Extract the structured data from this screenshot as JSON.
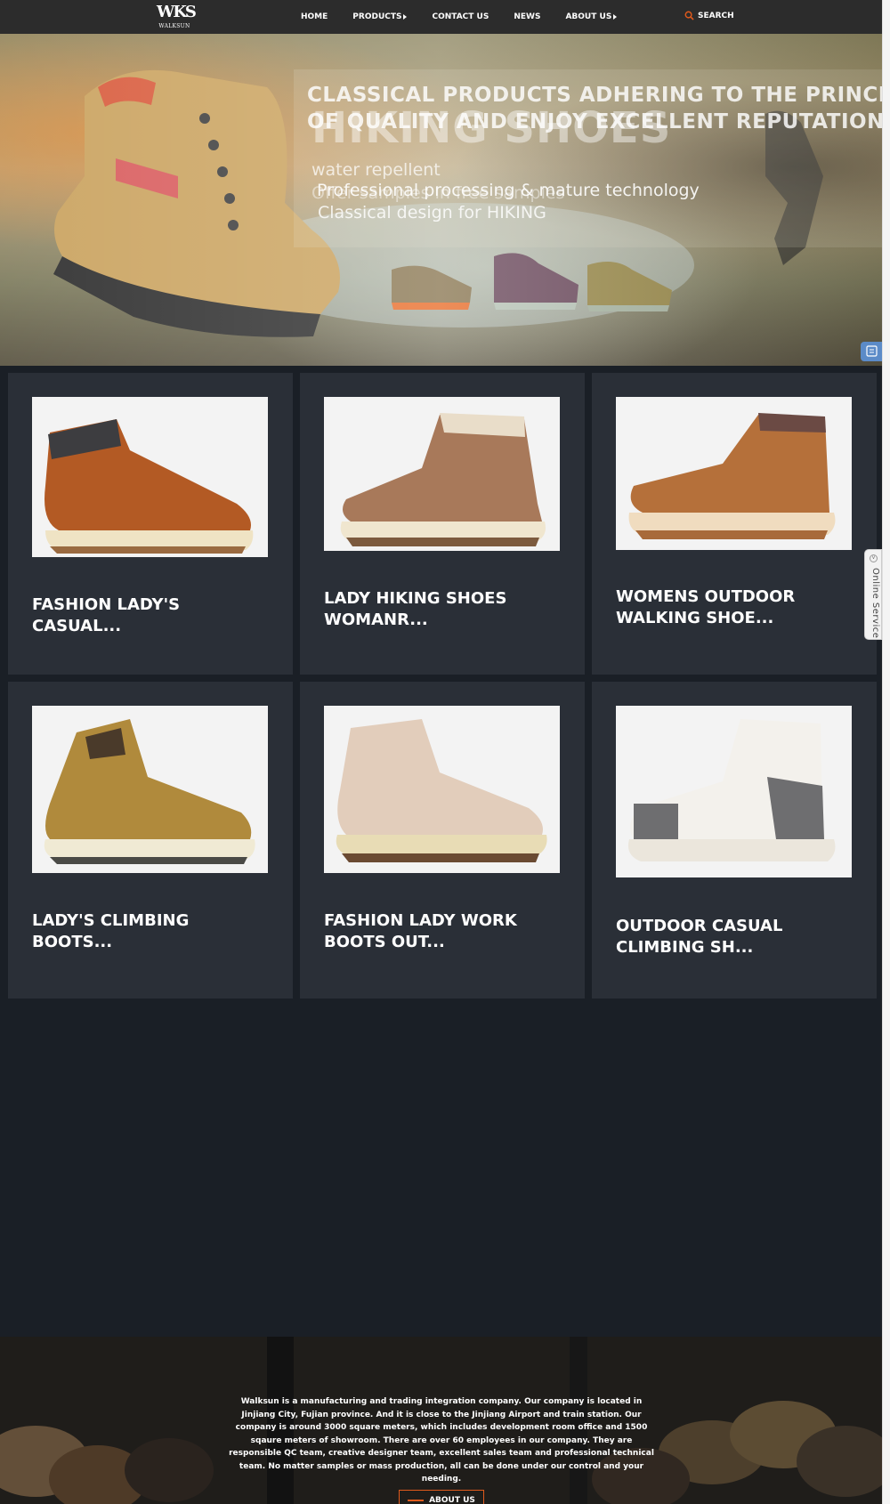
{
  "header": {
    "logo_mark": "WKS",
    "logo_text": "WALKSUN",
    "nav": [
      "HOME",
      "PRODUCTS",
      "CONTACT US",
      "NEWS",
      "ABOUT US"
    ],
    "search_label": "SEARCH"
  },
  "banner": {
    "line1": "CLASSICAL PRODUCTS   ADHERING TO THE PRINCIPLE",
    "line2": "OF QUALITY AND ENJOY EXCELLENT REPUTATION",
    "big_title": "HIKING SHOES",
    "sub1": "water repellent",
    "sub2": "Professional processing & mature technology",
    "sub2_ghost": "Offer samples in free samples",
    "sub3": "Classical design for HIKING"
  },
  "products": [
    {
      "title": "FASHION LADY'S CASUAL..."
    },
    {
      "title": "LADY HIKING SHOES WOMANR..."
    },
    {
      "title": "WOMENS OUTDOOR WALKING SHOE..."
    },
    {
      "title": "LADY'S CLIMBING BOOTS..."
    },
    {
      "title": "FASHION LADY WORK BOOTS OUT..."
    },
    {
      "title": "OUTDOOR CASUAL CLIMBING SH..."
    }
  ],
  "about": {
    "text": "Walksun is a manufacturing and trading integration company. Our company is located in Jinjiang City, Fujian province. And it is close to the Jinjiang Airport and train station. Our company is around 3000 square meters, which includes development room office and 1500 sqaure meters of showroom. There are over 60 employees in our company. They are responsible QC team, creative designer team, excellent sales team and professional technical team. No matter samples or mass production, all can be done under our control and your needing.",
    "button": "ABOUT US"
  },
  "online_service": {
    "label": "Online Service"
  },
  "colors": {
    "header_bg": "#2c2c2c",
    "page_bg": "#1a1f26",
    "card_bg": "#2a2f37",
    "accent": "#e05a1c"
  }
}
